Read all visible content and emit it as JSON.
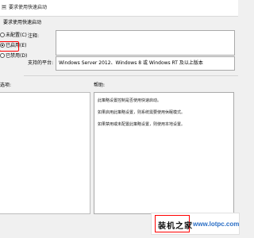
{
  "window": {
    "title": "要求使用快速启动"
  },
  "heading": "要求使用快速启动",
  "options": [
    {
      "label": "未配置(C)",
      "selected": false
    },
    {
      "label": "已启用(E)",
      "selected": true
    },
    {
      "label": "已禁用(D)",
      "selected": false
    }
  ],
  "comment": {
    "label": "注释:",
    "value": ""
  },
  "supported": {
    "label": "支持的平台:",
    "value": "Windows Server 2012、Windows 8 或 Windows RT 及以上版本"
  },
  "options_section": {
    "label": "选项:"
  },
  "help": {
    "label": "帮助:",
    "lines": [
      "此策略设置控制是否使用快速启动。",
      "如果启用此策略设置，则系统需要使用休眠模式。",
      "如果禁用或未配置此策略设置，则使用本地设置。"
    ]
  },
  "watermark": {
    "text": "装机之家",
    "url": "www.lotpc.com"
  },
  "colors": {
    "highlight": "#ff0000",
    "url": "#2a6ec5"
  }
}
